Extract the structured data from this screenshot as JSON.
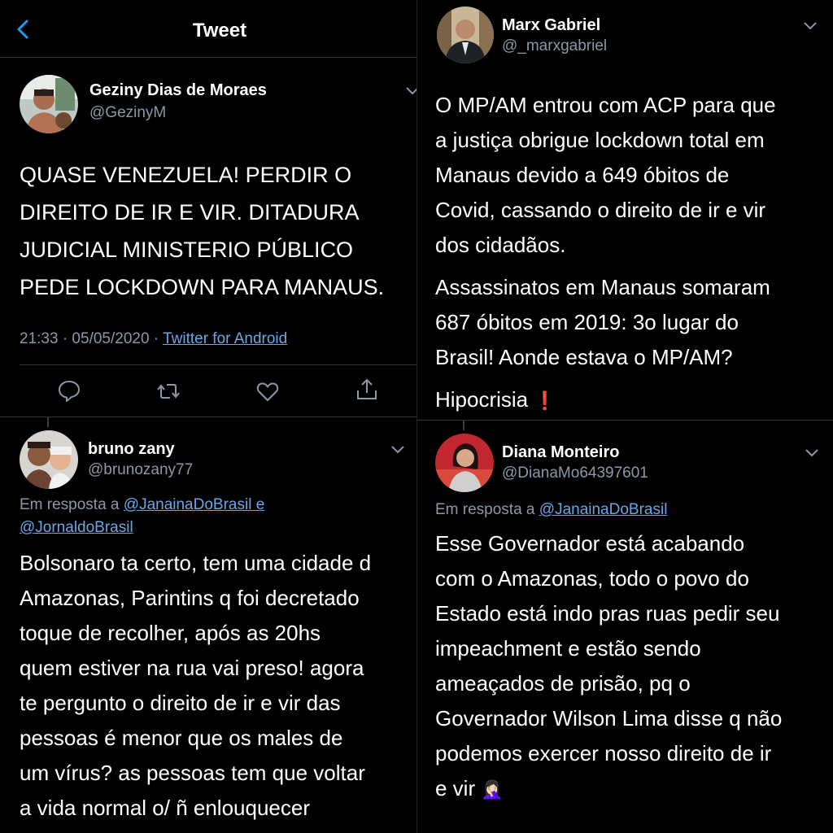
{
  "panel1": {
    "header": {
      "title": "Tweet"
    },
    "author": {
      "name": "Geziny Dias de Moraes",
      "handle": "@GezinyM"
    },
    "text_lines": [
      "QUASE VENEZUELA! PERDIR O",
      "DIREITO DE IR E VIR. DITADURA",
      "JUDICIAL MINISTERIO PÚBLICO",
      "PEDE LOCKDOWN PARA MANAUS."
    ],
    "timestamp": "21:33 · 05/05/2020 · ",
    "source": "Twitter for Android",
    "icons": [
      "reply-icon",
      "retweet-icon",
      "like-icon",
      "share-icon"
    ]
  },
  "panel2": {
    "author": {
      "name": "Marx Gabriel",
      "handle": "@_marxgabriel"
    },
    "para1_lines": [
      "O MP/AM entrou com  ACP para que",
      "a justiça obrigue lockdown total em",
      "Manaus devido a 649 óbitos de",
      "Covid, cassando o direito de ir e vir",
      "dos cidadãos."
    ],
    "para2_lines": [
      "Assassinatos em Manaus somaram",
      "687 óbitos em 2019: 3o lugar do",
      "Brasil! Aonde estava o MP/AM?"
    ],
    "para3": "Hipocrisia",
    "para3_emoji": "❗"
  },
  "panel3": {
    "author": {
      "name": "bruno zany",
      "handle": "@brunozany77"
    },
    "reply_prefix": "Em resposta a ",
    "reply_to_1": "@JanainaDoBrasil e",
    "reply_to_2": "@JornaldoBrasil",
    "text_lines": [
      "Bolsonaro ta certo, tem uma cidade d",
      "Amazonas, Parintins q foi decretado",
      "toque de recolher, após as 20hs",
      "quem estiver na rua vai preso! agora",
      "te pergunto o direito de ir e vir das",
      "pessoas é menor que os males de",
      "um vírus? as pessoas tem que voltar",
      "a vida normal o/ ñ enlouquecer"
    ]
  },
  "panel4": {
    "author": {
      "name": "Diana Monteiro",
      "handle": "@DianaMo64397601"
    },
    "reply_prefix": "Em resposta a ",
    "reply_to": "@JanainaDoBrasil",
    "text_lines": [
      "Esse Governador está acabando",
      "com o Amazonas, todo o povo do",
      "Estado está indo pras ruas pedir seu",
      "impeachment e estão sendo",
      "ameaçados de prisão, pq o",
      "Governador Wilson Lima disse q não",
      "podemos exercer nosso direito de ir",
      "e vir"
    ],
    "end_emoji": "🤦🏻‍♀️"
  }
}
